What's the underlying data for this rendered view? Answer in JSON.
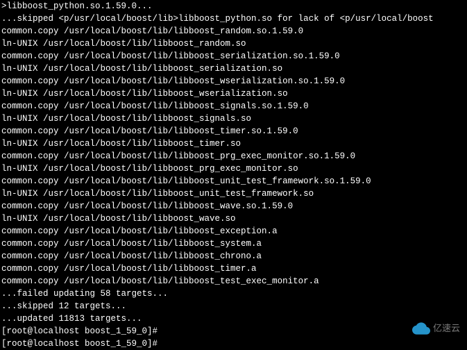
{
  "terminal": {
    "lines": [
      ">libboost_python.so.1.59.0...",
      "...skipped <p/usr/local/boost/lib>libboost_python.so for lack of <p/usr/local/boost",
      "common.copy /usr/local/boost/lib/libboost_random.so.1.59.0",
      "ln-UNIX /usr/local/boost/lib/libboost_random.so",
      "common.copy /usr/local/boost/lib/libboost_serialization.so.1.59.0",
      "ln-UNIX /usr/local/boost/lib/libboost_serialization.so",
      "common.copy /usr/local/boost/lib/libboost_wserialization.so.1.59.0",
      "ln-UNIX /usr/local/boost/lib/libboost_wserialization.so",
      "common.copy /usr/local/boost/lib/libboost_signals.so.1.59.0",
      "ln-UNIX /usr/local/boost/lib/libboost_signals.so",
      "common.copy /usr/local/boost/lib/libboost_timer.so.1.59.0",
      "ln-UNIX /usr/local/boost/lib/libboost_timer.so",
      "common.copy /usr/local/boost/lib/libboost_prg_exec_monitor.so.1.59.0",
      "ln-UNIX /usr/local/boost/lib/libboost_prg_exec_monitor.so",
      "common.copy /usr/local/boost/lib/libboost_unit_test_framework.so.1.59.0",
      "ln-UNIX /usr/local/boost/lib/libboost_unit_test_framework.so",
      "common.copy /usr/local/boost/lib/libboost_wave.so.1.59.0",
      "ln-UNIX /usr/local/boost/lib/libboost_wave.so",
      "common.copy /usr/local/boost/lib/libboost_exception.a",
      "common.copy /usr/local/boost/lib/libboost_system.a",
      "common.copy /usr/local/boost/lib/libboost_chrono.a",
      "common.copy /usr/local/boost/lib/libboost_timer.a",
      "common.copy /usr/local/boost/lib/libboost_test_exec_monitor.a",
      "...failed updating 58 targets...",
      "...skipped 12 targets...",
      "...updated 11813 targets...",
      "[root@localhost boost_1_59_0]#",
      "[root@localhost boost_1_59_0]#"
    ]
  },
  "watermark": {
    "text": "亿速云"
  }
}
